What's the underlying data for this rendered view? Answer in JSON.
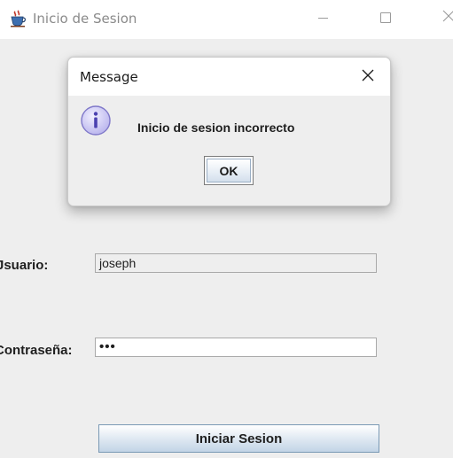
{
  "window": {
    "title": "Inicio de Sesion",
    "icon": "java-coffee-cup-icon"
  },
  "form": {
    "user_label": "Jsuario:",
    "user_value": "joseph",
    "password_label": "Contraseña:",
    "password_masked": "•••",
    "submit_label": "Iniciar Sesion"
  },
  "dialog": {
    "title": "Message",
    "icon": "info-icon",
    "message": "Inicio de sesion incorrecto",
    "ok_label": "OK"
  },
  "colors": {
    "info_icon_fill": "#c9c6f0",
    "info_icon_border": "#7f78c9",
    "button_border": "#7a99b4"
  }
}
